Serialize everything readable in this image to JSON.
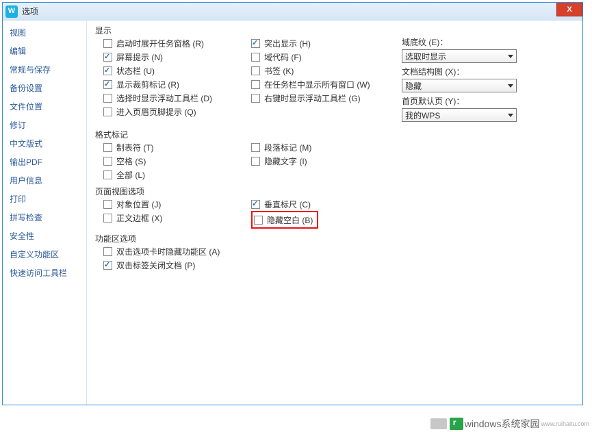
{
  "title": "选项",
  "close_x": "X",
  "sidebar": {
    "items": [
      {
        "label": "视图"
      },
      {
        "label": "编辑"
      },
      {
        "label": "常规与保存"
      },
      {
        "label": "备份设置"
      },
      {
        "label": "文件位置"
      },
      {
        "label": "修订"
      },
      {
        "label": "中文版式"
      },
      {
        "label": "输出PDF"
      },
      {
        "label": "用户信息"
      },
      {
        "label": "打印"
      },
      {
        "label": "拼写检查"
      },
      {
        "label": "安全性"
      },
      {
        "label": "自定义功能区"
      },
      {
        "label": "快速访问工具栏"
      }
    ]
  },
  "groups": {
    "display": {
      "title": "显示",
      "col1": [
        {
          "label": "启动时展开任务窗格 (R)",
          "checked": false
        },
        {
          "label": "屏幕提示 (N)",
          "checked": true
        },
        {
          "label": "状态栏 (U)",
          "checked": true
        },
        {
          "label": "显示裁剪标记 (R)",
          "checked": true
        },
        {
          "label": "选择时显示浮动工具栏 (D)",
          "checked": false
        },
        {
          "label": "进入页眉页脚提示 (Q)",
          "checked": false
        }
      ],
      "col2": [
        {
          "label": "突出显示 (H)",
          "checked": true
        },
        {
          "label": "域代码 (F)",
          "checked": false
        },
        {
          "label": "书签 (K)",
          "checked": false
        },
        {
          "label": "在任务栏中显示所有窗口 (W)",
          "checked": false
        },
        {
          "label": "右键时显示浮动工具栏 (G)",
          "checked": false
        }
      ],
      "col3": {
        "shading": {
          "label": "域底纹 (E)：",
          "value": "选取时显示"
        },
        "doc_map": {
          "label": "文档结构图 (X)：",
          "value": "隐藏"
        },
        "homepage": {
          "label": "首页默认页 (Y)：",
          "value": "我的WPS"
        }
      }
    },
    "format_marks": {
      "title": "格式标记",
      "col1": [
        {
          "label": "制表符 (T)",
          "checked": false
        },
        {
          "label": "空格 (S)",
          "checked": false
        },
        {
          "label": "全部 (L)",
          "checked": false
        }
      ],
      "col2": [
        {
          "label": "段落标记 (M)",
          "checked": false
        },
        {
          "label": "隐藏文字 (I)",
          "checked": false
        }
      ]
    },
    "page_view": {
      "title": "页面视图选项",
      "col1": [
        {
          "label": "对象位置 (J)",
          "checked": false
        },
        {
          "label": "正文边框 (X)",
          "checked": false
        }
      ],
      "col2": [
        {
          "label": "垂直标尺 (C)",
          "checked": true
        },
        {
          "label": "隐藏空白 (B)",
          "checked": false,
          "highlight": true
        }
      ]
    },
    "ribbon": {
      "title": "功能区选项",
      "items": [
        {
          "label": "双击选项卡时隐藏功能区 (A)",
          "checked": false
        },
        {
          "label": "双击标签关闭文档 (P)",
          "checked": true
        }
      ]
    }
  },
  "watermark": {
    "text": "windows系统家园",
    "url": "www.ruihaitu.com"
  }
}
